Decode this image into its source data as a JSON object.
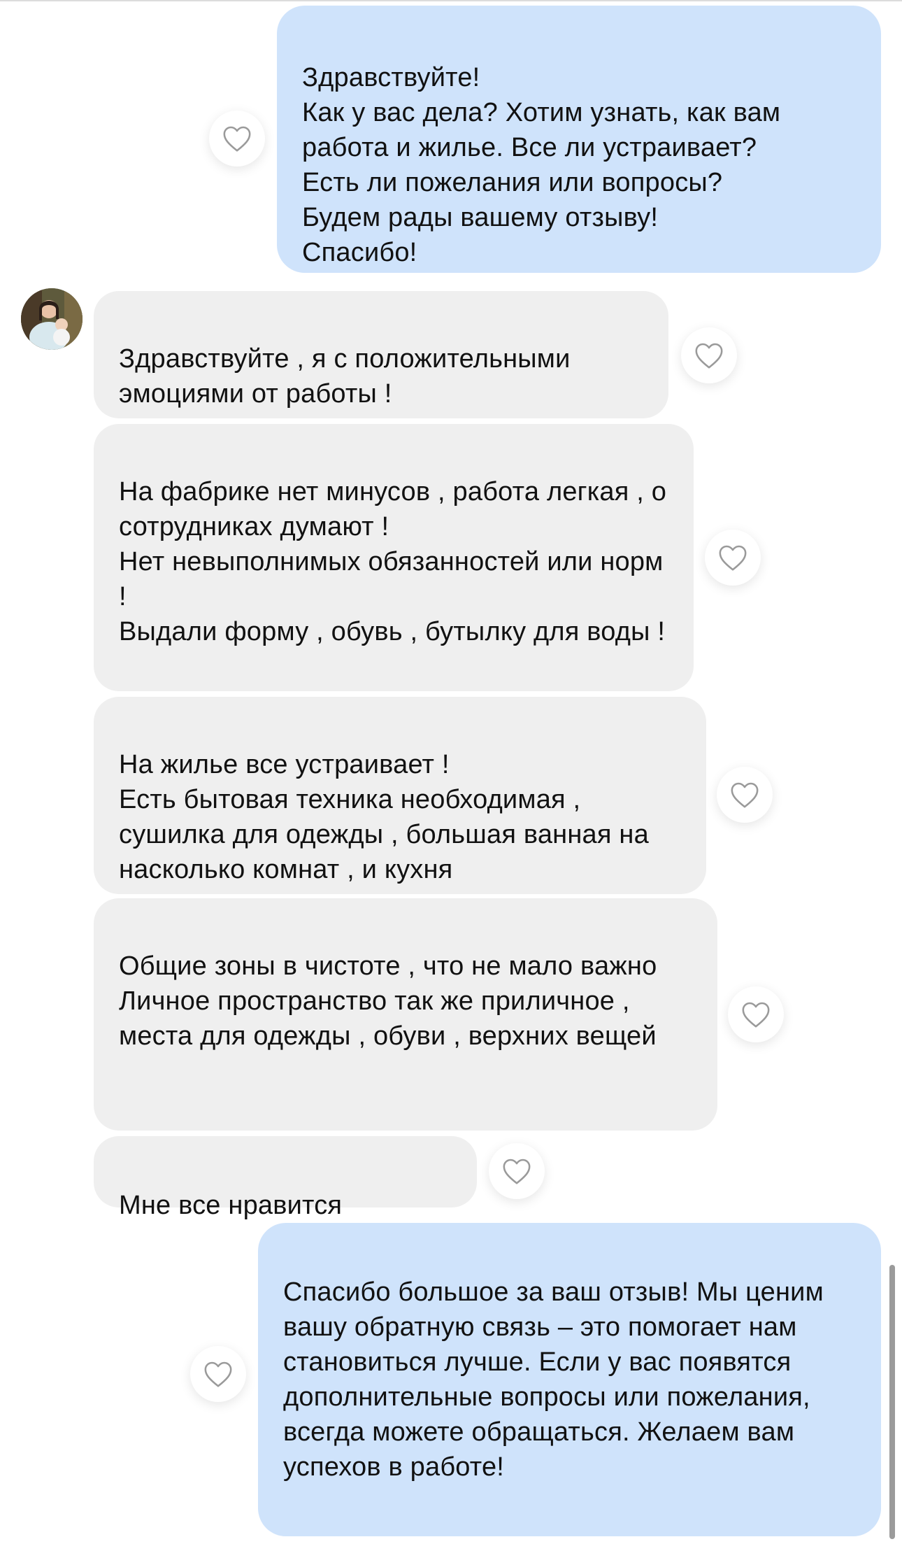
{
  "messages": [
    {
      "direction": "outgoing",
      "text": "Здравствуйте!\nКак у вас дела? Хотим узнать, как вам работа и жилье. Все ли устраивает?\nЕсть ли пожелания или вопросы?\nБудем рады вашему отзыву!\nСпасибо!"
    },
    {
      "direction": "incoming",
      "text": "Здравствуйте , я с положительными эмоциями от работы !"
    },
    {
      "direction": "incoming",
      "text": "На фабрике нет минусов , работа легкая , о сотрудниках думают !\nНет невыполнимых обязанностей или норм !\nВыдали форму , обувь , бутылку для воды !"
    },
    {
      "direction": "incoming",
      "text": "На жилье все устраивает !\nЕсть бытовая техника необходимая , сушилка для одежды , большая ванная на насколько комнат , и кухня"
    },
    {
      "direction": "incoming",
      "text": "Общие зоны в чистоте , что не мало важно\nЛичное пространство так же приличное , места для одежды , обуви , верхних вещей"
    },
    {
      "direction": "incoming",
      "text": "Мне все нравится"
    },
    {
      "direction": "outgoing",
      "text": "Спасибо большое за ваш отзыв! Мы ценим вашу обратную связь – это помогает нам становиться лучше. Если у вас появятся дополнительные вопросы или пожелания, всегда можете обращаться. Желаем вам успехов в работе!"
    }
  ],
  "icons": {
    "like": "heart-outline-icon",
    "avatar": "user-avatar-photo"
  },
  "colors": {
    "outgoing_bubble": "#cfe3fb",
    "incoming_bubble": "#efefef",
    "heart_stroke": "#9a9a9a"
  }
}
